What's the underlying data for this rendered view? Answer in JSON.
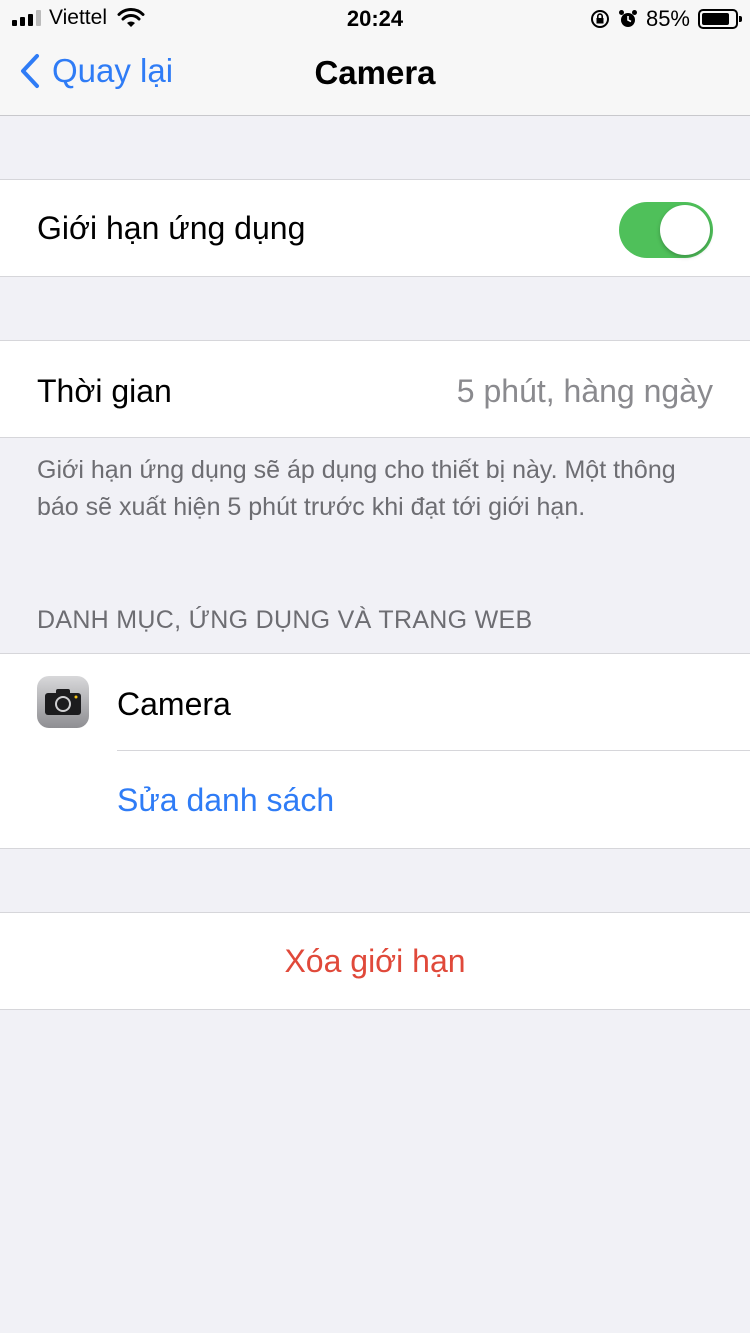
{
  "status_bar": {
    "carrier": "Viettel",
    "time": "20:24",
    "battery_percent": "85%",
    "battery_level": 0.85,
    "icons": [
      "signal-icon",
      "wifi-icon",
      "orientation-lock-icon",
      "alarm-icon",
      "battery-icon"
    ]
  },
  "nav": {
    "back_label": "Quay lại",
    "title": "Camera"
  },
  "limit_toggle": {
    "label": "Giới hạn ứng dụng",
    "on": true,
    "color": "#4fc05a"
  },
  "time_row": {
    "label": "Thời gian",
    "value": "5 phút, hàng ngày"
  },
  "footnote": "Giới hạn ứng dụng sẽ áp dụng cho thiết bị này. Một thông báo sẽ xuất hiện 5 phút trước khi đạt tới giới hạn.",
  "section": {
    "header": "DANH MỤC, ỨNG DỤNG VÀ TRANG WEB",
    "app_name": "Camera",
    "edit_list": "Sửa danh sách"
  },
  "delete_limit": "Xóa giới hạn",
  "colors": {
    "accent": "#2f7cf6",
    "destructive": "#e0493a",
    "background": "#f1f1f6"
  }
}
